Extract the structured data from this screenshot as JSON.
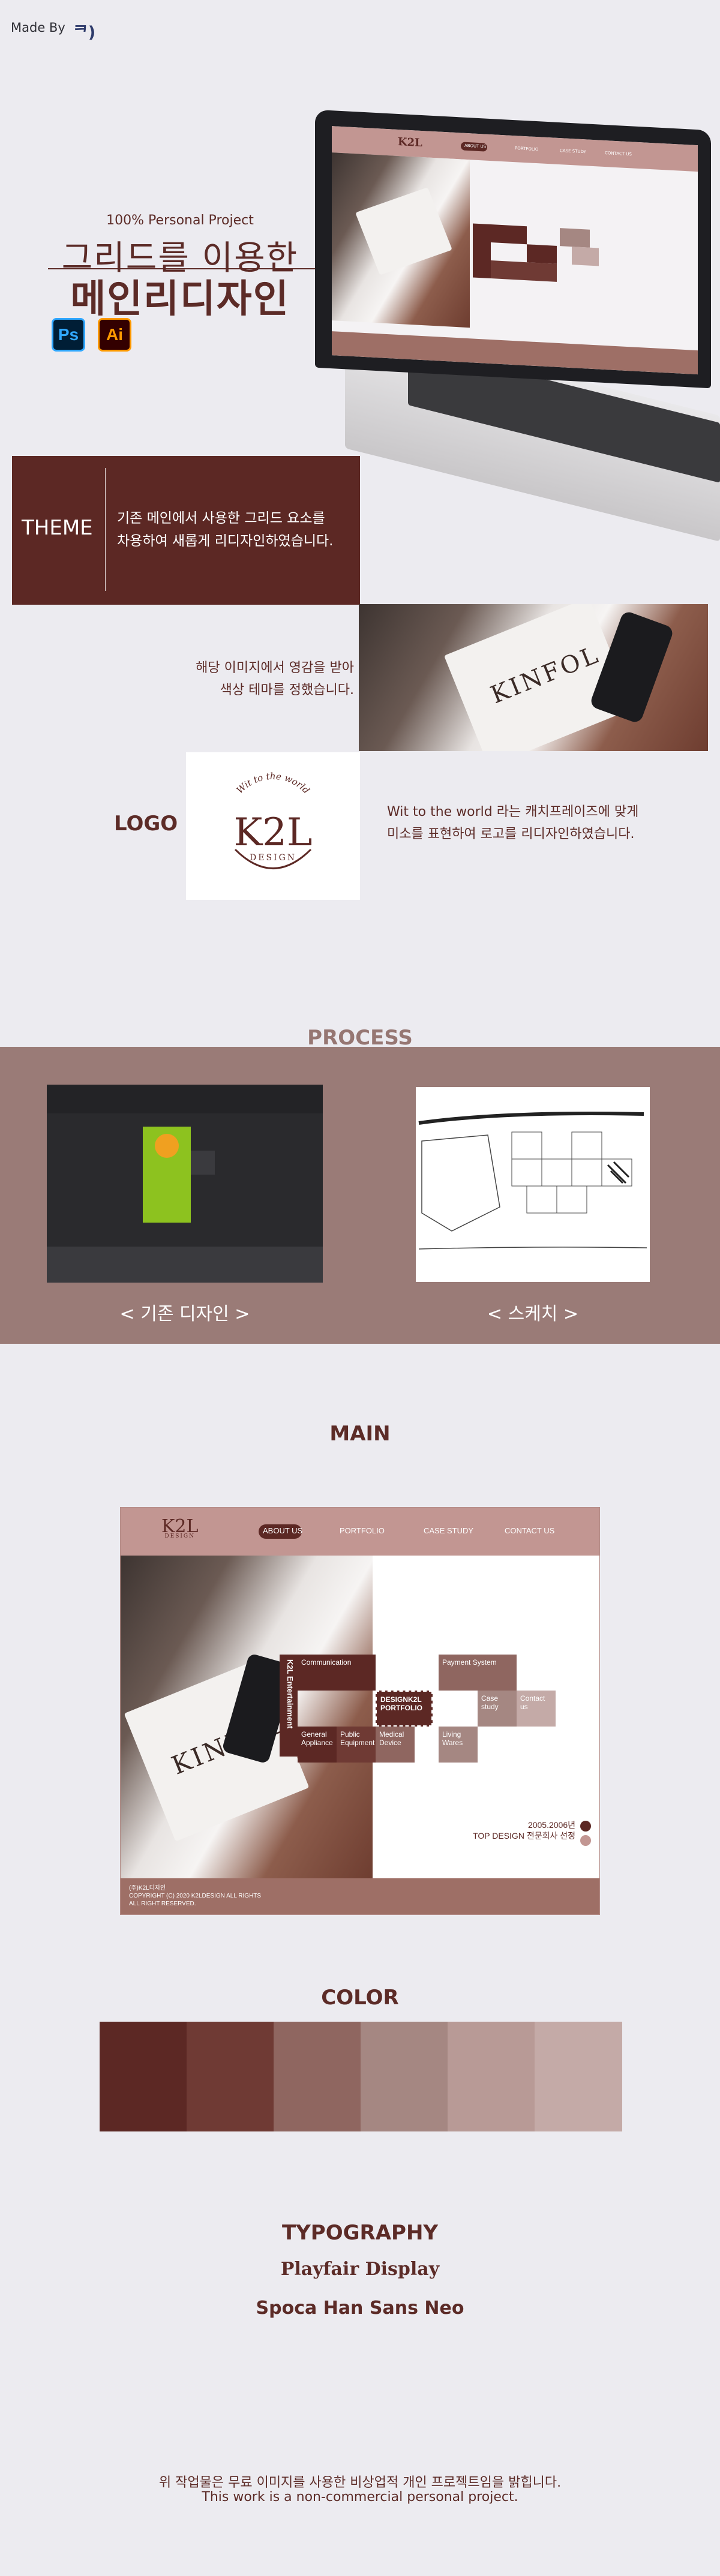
{
  "header": {
    "made_by": "Made By",
    "made_by_logo": "ᄏ)",
    "subtitle": "100% Personal Project",
    "title_line1": "그리드를 이용한",
    "title_line2": "메인리디자인",
    "tools": [
      "Ps",
      "Ai"
    ]
  },
  "laptop_preview": {
    "brand": "K2L",
    "nav": [
      "ABOUT US",
      "PORTFOLIO",
      "CASE STUDY",
      "CONTACT US"
    ]
  },
  "theme": {
    "label": "THEME",
    "description_line1": "기존 메인에서 사용한 그리드 요소를",
    "description_line2": "차용하여 새롭게 리디자인하였습니다.",
    "inspiration_line1": "해당 이미지에서 영감을 받아",
    "inspiration_line2": "색상 테마를 정했습니다."
  },
  "logo": {
    "label": "LOGO",
    "arc_text": "Wit to the world",
    "mark": "K2L",
    "sub": "DESIGN",
    "description_line1": "Wit to the world 라는 캐치프레이즈에 맞게",
    "description_line2": "미소를 표현하여 로고를 리디자인하였습니다."
  },
  "process": {
    "title": "PROCESS",
    "old_caption": "< 기존 디자인 >",
    "sketch_caption": "< 스케치 >"
  },
  "main": {
    "title": "MAIN",
    "brand": "K2L",
    "brand_sub": "DESIGN",
    "nav": [
      "ABOUT US",
      "PORTFOLIO",
      "CASE STUDY",
      "CONTACT US"
    ],
    "vertical_label": "K2L Entertainment",
    "tiles": {
      "communication": "Communication",
      "payment": "Payment System",
      "portfolio": "DESIGNK2L PORTFOLIO",
      "case_study": "Case study",
      "contact": "Contact us",
      "general": "General Appliance",
      "public": "Public Equipment",
      "medical": "Medical Device",
      "living": "Living Wares"
    },
    "since": "2005.2006년",
    "award": "TOP DESIGN 전문회사 선정",
    "footer_line1": "(주)K2L디자인",
    "footer_line2": "COPYRIGHT (C) 2020 K2LDESIGN ALL RIGHTS",
    "footer_line3": "ALL RIGHT RESERVED."
  },
  "color": {
    "title": "COLOR",
    "swatches": [
      "#5c2824",
      "#6f3a34",
      "#8f6660",
      "#a58782",
      "#b89a96",
      "#c4aaa7"
    ]
  },
  "typography": {
    "title": "TYPOGRAPHY",
    "font1": "Playfair Display",
    "font2": "Spoca Han Sans Neo"
  },
  "footer": {
    "line1": "위 작업물은 무료 이미지를 사용한 비상업적 개인 프로젝트임을 밝힙니다.",
    "line2": "This work is a non-commercial personal project."
  }
}
